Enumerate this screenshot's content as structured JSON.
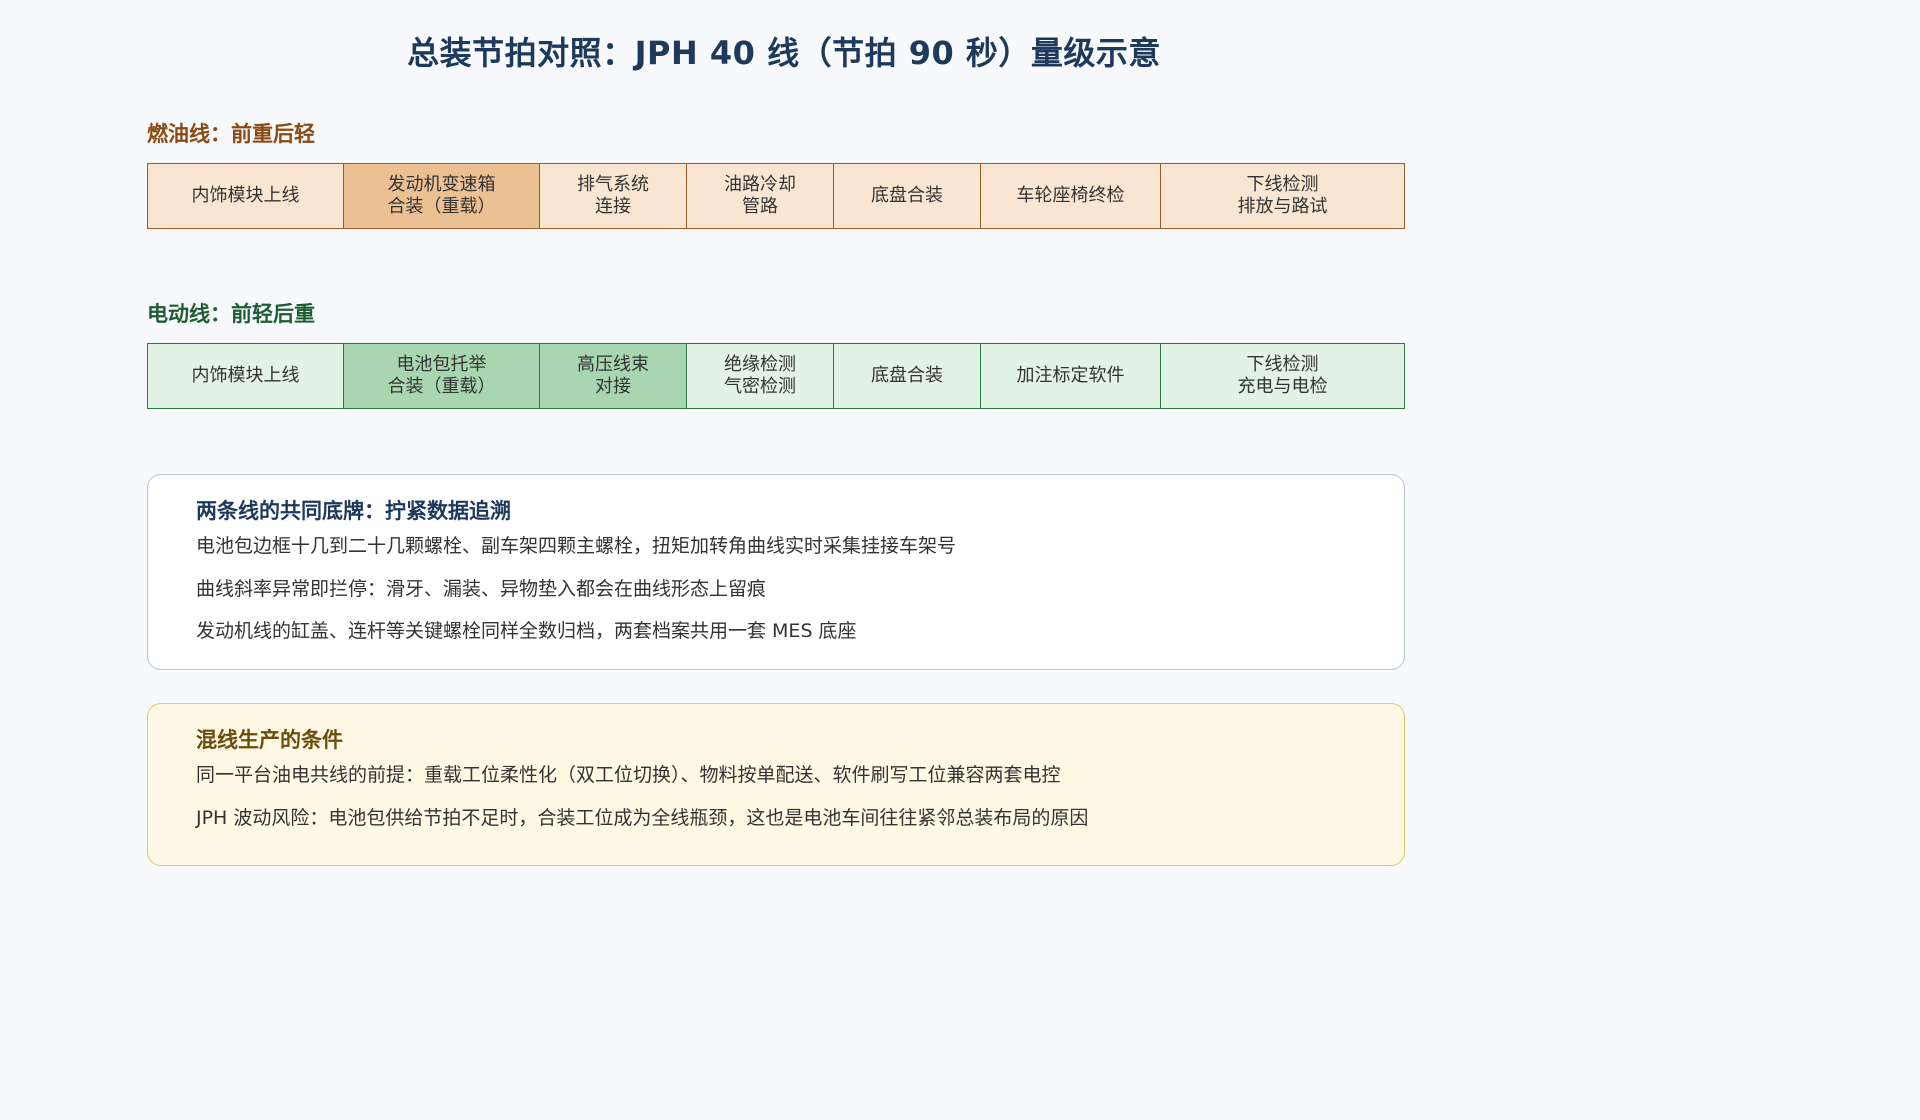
{
  "title": "总装节拍对照：JPH 40 线（节拍 90 秒）量级示意",
  "fuel_line": {
    "label": "燃油线：前重后轻",
    "stations": [
      "内饰模块上线",
      "发动机变速箱\n合装（重载）",
      "排气系统\n连接",
      "油路冷却\n管路",
      "底盘合装",
      "车轮座椅终检",
      "下线检测\n排放与路试"
    ]
  },
  "ev_line": {
    "label": "电动线：前轻后重",
    "stations": [
      "内饰模块上线",
      "电池包托举\n合装（重载）",
      "高压线束\n对接",
      "绝缘检测\n气密检测",
      "底盘合装",
      "加注标定软件",
      "下线检测\n充电与电检"
    ]
  },
  "common_box": {
    "title": "两条线的共同底牌：拧紧数据追溯",
    "lines": [
      "电池包边框十几到二十几颗螺栓、副车架四颗主螺栓，扭矩加转角曲线实时采集挂接车架号",
      "曲线斜率异常即拦停：滑牙、漏装、异物垫入都会在曲线形态上留痕",
      "发动机线的缸盖、连杆等关键螺栓同样全数归档，两套档案共用一套 MES 底座"
    ]
  },
  "mixed_box": {
    "title": "混线生产的条件",
    "lines": [
      "同一平台油电共线的前提：重载工位柔性化（双工位切换）、物料按单配送、软件刷写工位兼容两套电控",
      "JPH 波动风险：电池包供给节拍不足时，合装工位成为全线瓶颈，这也是电池车间往往紧邻总装布局的原因"
    ]
  },
  "colors": {
    "fuel_accent": "#9a5b28",
    "fuel_heavy": "#ebc194",
    "ev_accent": "#2e7a43",
    "ev_heavy": "#a8d6b0"
  }
}
